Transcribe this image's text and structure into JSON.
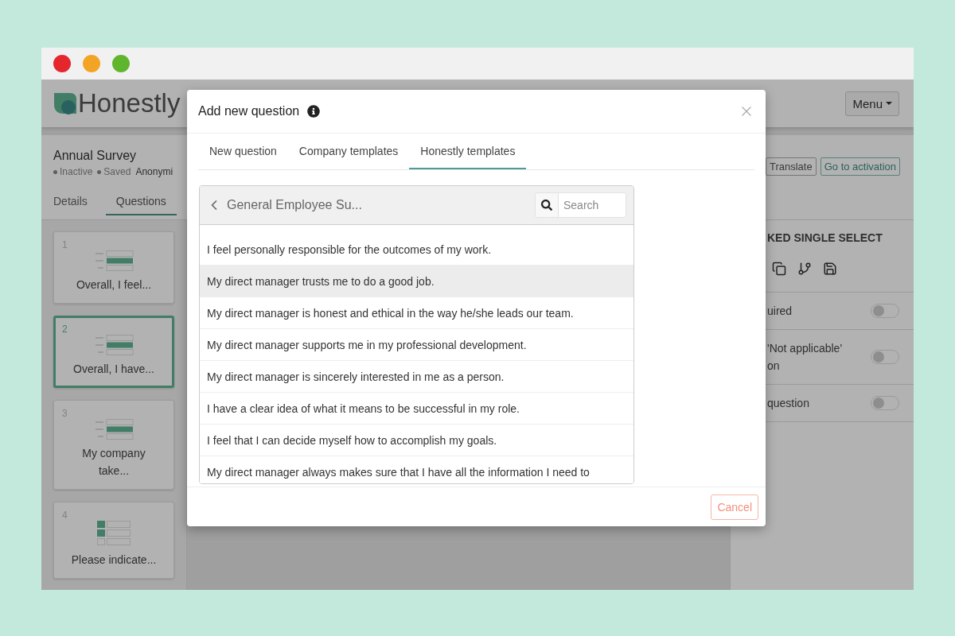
{
  "app": {
    "logo": "Honestly",
    "menu_button": "Menu"
  },
  "survey": {
    "title": "Annual Survey",
    "statuses": [
      "Inactive",
      "Saved"
    ],
    "anonymity": "Anonymi",
    "tabs": [
      {
        "label": "Details",
        "selected": false
      },
      {
        "label": "Questions",
        "selected": true
      }
    ]
  },
  "actions": [
    {
      "label": "Translate",
      "kind": "default"
    },
    {
      "label": "Go to activation",
      "kind": "primary"
    }
  ],
  "questions": [
    {
      "number": "1",
      "kind": "single_select",
      "label": "Overall, I feel...",
      "selected": false
    },
    {
      "number": "2",
      "kind": "single_select",
      "label": "Overall, I have...",
      "selected": true
    },
    {
      "number": "3",
      "kind": "single_select",
      "label": "My company take...",
      "selected": false
    },
    {
      "number": "4",
      "kind": "multi_select",
      "label": "Please indicate...",
      "selected": false
    }
  ],
  "question_settings": {
    "type_label": "KED SINGLE SELECT",
    "options": [
      {
        "lines": [
          "uired"
        ],
        "on": false
      },
      {
        "lines": [
          "'Not applicable'",
          "on"
        ],
        "on": false
      },
      {
        "lines": [
          "question"
        ],
        "on": false
      }
    ]
  },
  "modal": {
    "title": "Add new question",
    "tabs": [
      {
        "label": "New question",
        "selected": false
      },
      {
        "label": "Company templates",
        "selected": false
      },
      {
        "label": "Honestly templates",
        "selected": true
      }
    ],
    "template_browser": {
      "title": "General Employee Su...",
      "search": {
        "placeholder": "Search"
      },
      "items": [
        {
          "text": "I feel personally responsible for the outcomes of my work.",
          "selected": false
        },
        {
          "text": "My direct manager trusts me to do a good job.",
          "selected": true
        },
        {
          "text": "My direct manager is honest and ethical in the way he/she leads our team.",
          "selected": false
        },
        {
          "text": "My direct manager supports me in my professional development.",
          "selected": false
        },
        {
          "text": "My direct manager is sincerely interested in me as a person.",
          "selected": false
        },
        {
          "text": "I have a clear idea of what it means to be successful in my role.",
          "selected": false
        },
        {
          "text": "I feel that I can decide myself how to accomplish my goals.",
          "selected": false
        },
        {
          "text": "My direct manager always makes sure that I have all the information I need to",
          "selected": false
        }
      ]
    },
    "cancel_button": "Cancel"
  }
}
